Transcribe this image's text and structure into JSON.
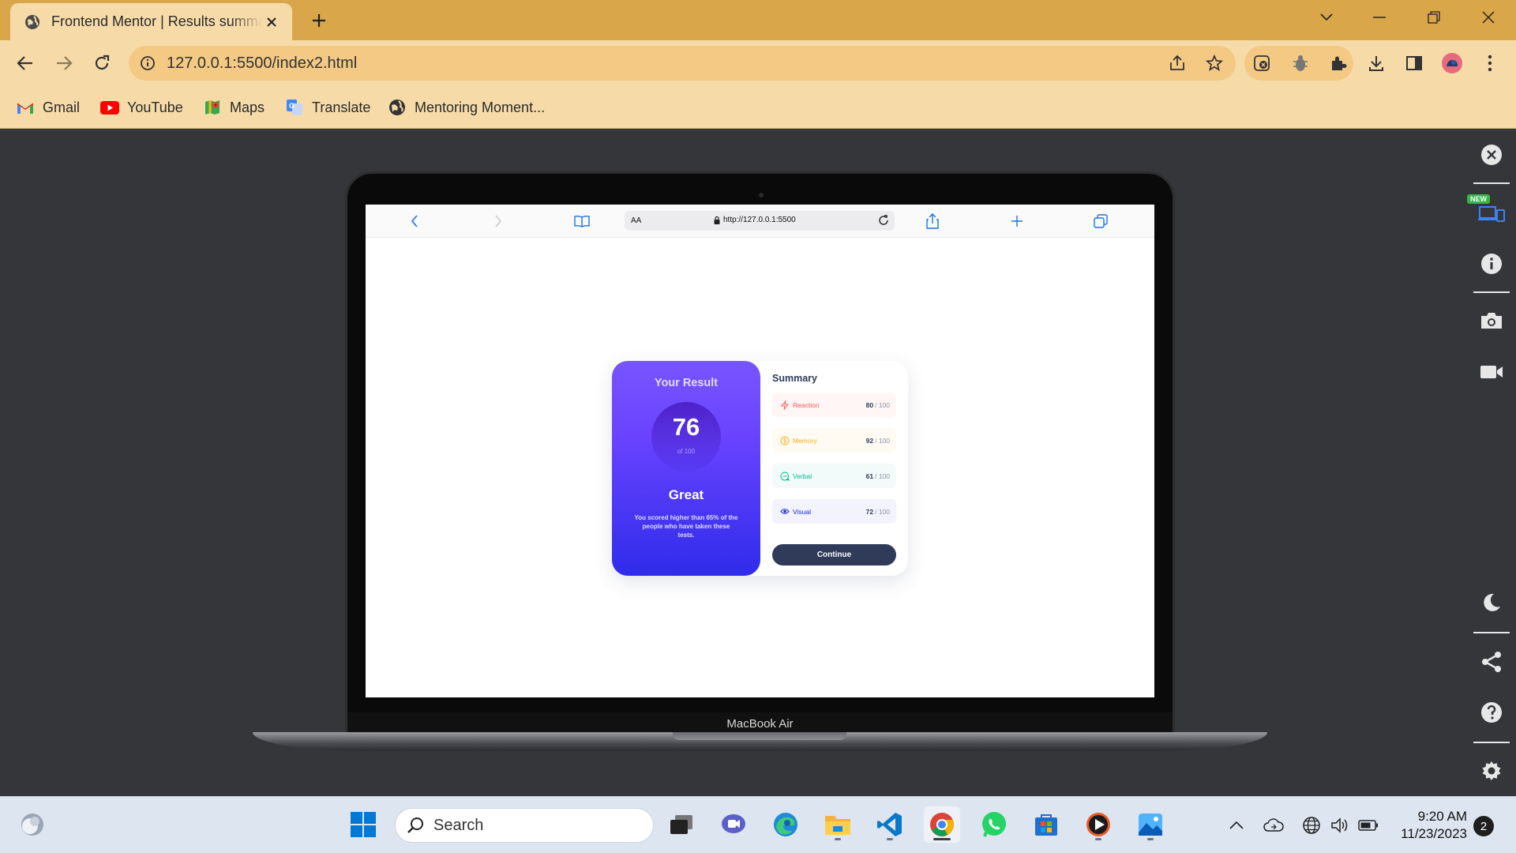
{
  "browser": {
    "tab_title": "Frontend Mentor | Results summary component",
    "url": "127.0.0.1:5500/index2.html",
    "bookmarks": [
      {
        "label": "Gmail",
        "icon": "gmail-icon"
      },
      {
        "label": "YouTube",
        "icon": "youtube-icon"
      },
      {
        "label": "Maps",
        "icon": "maps-icon"
      },
      {
        "label": "Translate",
        "icon": "translate-icon"
      },
      {
        "label": "Mentoring Moment...",
        "icon": "globe-icon"
      }
    ]
  },
  "device": {
    "label": "MacBook Air",
    "safari_aa": "AA",
    "safari_url": "http://127.0.0.1:5500"
  },
  "result": {
    "title": "Your Result",
    "score": "76",
    "score_of": "of 100",
    "verdict": "Great",
    "description": "You scored higher than 65% of the people who have taken these tests."
  },
  "summary": {
    "title": "Summary",
    "items": [
      {
        "label": "Reaction",
        "value": "80",
        "max": "/ 100",
        "icon": "lightning-icon",
        "color": "#ff5757",
        "bg": "#fff6f5"
      },
      {
        "label": "Memory",
        "value": "92",
        "max": "/ 100",
        "icon": "brain-icon",
        "color": "#ffb01f",
        "bg": "#fffbf2"
      },
      {
        "label": "Verbal",
        "value": "61",
        "max": "/ 100",
        "icon": "chat-icon",
        "color": "#00bb8f",
        "bg": "#f2fbfa"
      },
      {
        "label": "Visual",
        "value": "72",
        "max": "/ 100",
        "icon": "eye-icon",
        "color": "#1125d6",
        "bg": "#f3f3fd"
      }
    ],
    "button": "Continue"
  },
  "panel": {
    "new_badge": "NEW"
  },
  "taskbar": {
    "search_placeholder": "Search",
    "time": "9:20 AM",
    "date": "11/23/2023",
    "notifications": "2"
  },
  "colors": {
    "chrome_frame": "#d9a74a",
    "chrome_toolbar": "#f6dba8",
    "page_bg": "#35363a",
    "accent_dark": "#303b5a"
  }
}
